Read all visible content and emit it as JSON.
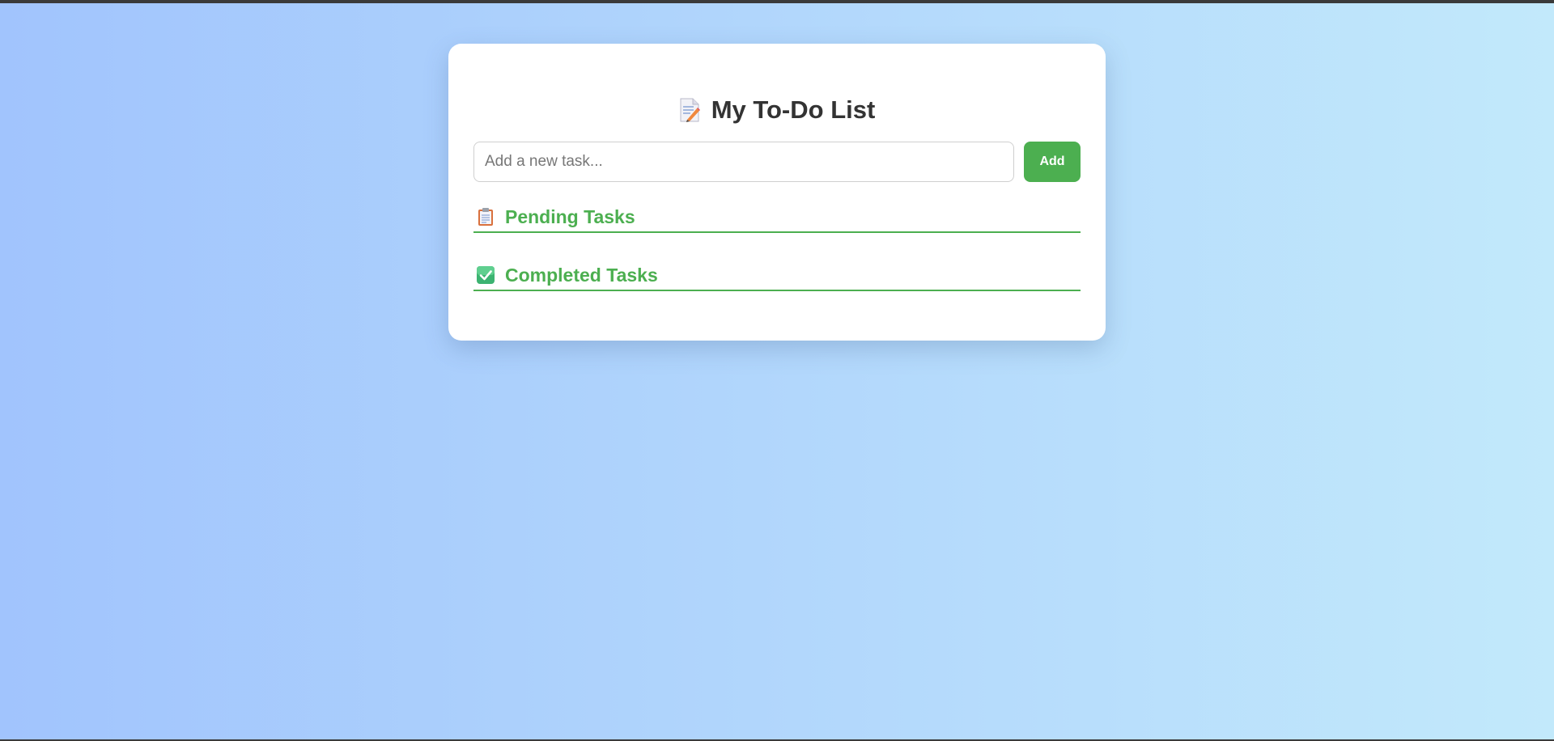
{
  "app": {
    "title": "My To-Do List",
    "title_icon": "memo-icon"
  },
  "input": {
    "placeholder": "Add a new task...",
    "value": ""
  },
  "add_button": {
    "label": "Add"
  },
  "sections": [
    {
      "title": "Pending Tasks",
      "icon": "clipboard-icon",
      "items": []
    },
    {
      "title": "Completed Tasks",
      "icon": "check-box-icon",
      "items": []
    }
  ],
  "colors": {
    "accent": "#4caf50",
    "title_text": "#333333",
    "background_start": "#a1c4fd",
    "background_end": "#c2e9fb",
    "card": "#ffffff"
  }
}
